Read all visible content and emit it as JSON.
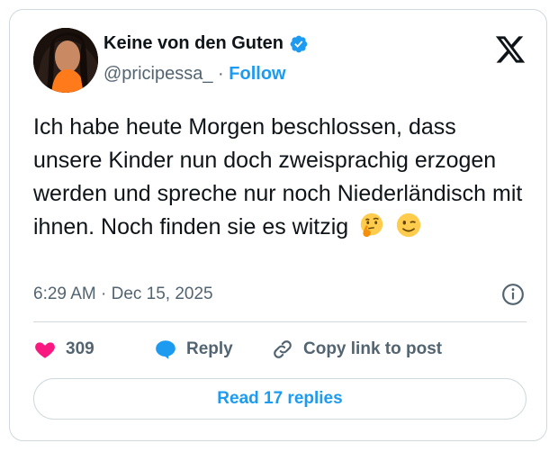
{
  "author": {
    "display_name": "Keine von den Guten",
    "handle": "@pricipessa_",
    "separator": "·",
    "follow_label": "Follow"
  },
  "tweet": {
    "text": "Ich habe heute Morgen beschlossen, dass unsere Kinder nun doch zweisprachig erzogen werden und spreche nur noch Niederländisch mit ihnen. Noch finden sie es witzig",
    "emojis": [
      "thinking-face",
      "winking-face"
    ],
    "timestamp": "6:29 AM · Dec 15, 2025"
  },
  "actions": {
    "like_count": "309",
    "reply_label": "Reply",
    "copy_label": "Copy link to post"
  },
  "footer": {
    "read_replies_label": "Read 17 replies"
  },
  "colors": {
    "accent": "#1d9bf0",
    "like": "#f91880",
    "text": "#0f1419",
    "muted": "#536471",
    "border": "#cfd9de"
  }
}
